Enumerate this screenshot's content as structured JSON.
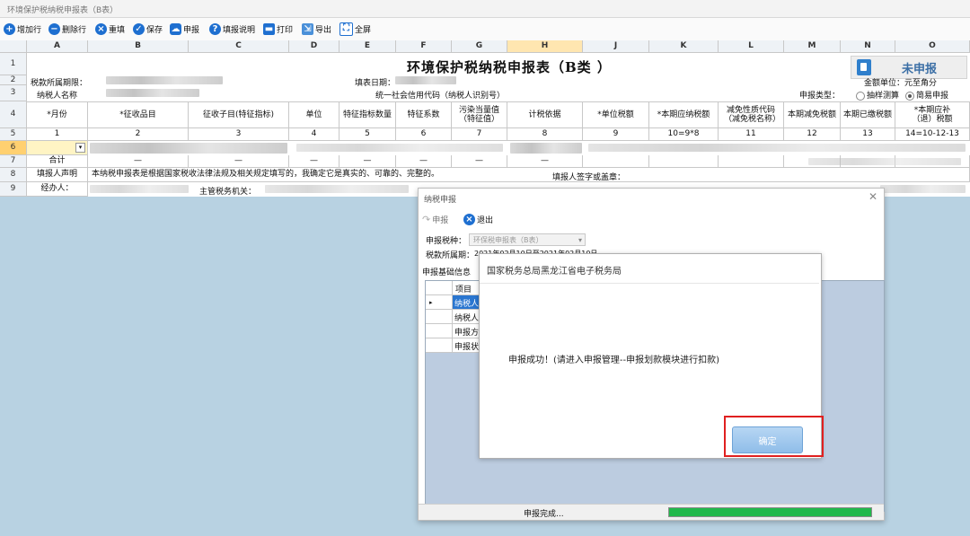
{
  "window": {
    "title": "环境保护税纳税申报表（B表）"
  },
  "toolbar": {
    "items": [
      {
        "icon": "plus-icon",
        "label": "增加行"
      },
      {
        "icon": "minus-icon",
        "label": "删除行"
      },
      {
        "icon": "close-icon",
        "label": "重填"
      },
      {
        "icon": "check-icon",
        "label": "保存"
      },
      {
        "icon": "cloud-upload-icon",
        "label": "申报"
      },
      {
        "icon": "help-icon",
        "label": "填报说明"
      },
      {
        "icon": "print-icon",
        "label": "打印"
      },
      {
        "icon": "export-icon",
        "label": "导出"
      },
      {
        "icon": "fullscreen-icon",
        "label": "全屏"
      }
    ]
  },
  "sheet": {
    "columns": [
      "A",
      "B",
      "C",
      "D",
      "E",
      "F",
      "G",
      "H",
      "J",
      "K",
      "L",
      "M",
      "N",
      "O"
    ],
    "selected_column": "H",
    "rows": [
      "1",
      "2",
      "3",
      "4",
      "5",
      "6",
      "7",
      "8",
      "9"
    ],
    "selected_row": "6",
    "title": "环境保护税纳税申报表（B类 ）",
    "status": "未申报",
    "period_label": "税款所属期限：",
    "fill_date_label": "填表日期：",
    "unit_label": "金额单位：元至角分",
    "taxpayer_label": "纳税人名称",
    "credit_code_label": "统一社会信用代码（纳税人识别号）",
    "declare_type_label": "申报类型：",
    "declare_option_1": "抽样测算",
    "declare_option_2": "简易申报",
    "headers": [
      "*月份",
      "*征收品目",
      "征收子目(特征指标)",
      "单位",
      "特征指标数量",
      "特征系数",
      "污染当量值（特征值）",
      "计税依据",
      "*单位税额",
      "*本期应纳税额",
      "减免性质代码（减免税名称）",
      "本期减免税额",
      "本期已缴税额",
      "*本期应补（退）税额"
    ],
    "numbers": [
      "1",
      "2",
      "3",
      "4",
      "5",
      "6",
      "7",
      "8",
      "9",
      "10=9*8",
      "11",
      "12",
      "13",
      "14=10-12-13"
    ],
    "total_label": "合计",
    "dash": "—",
    "declaration_label": "填报人声明",
    "declaration_text": "本纳税申报表是根据国家税收法律法规及相关规定填写的，我确定它是真实的、可靠的、完整的。",
    "signature_label": "填报人签字或盖章：",
    "agent_label": "经办人：",
    "tax_authority_label": "主管税务机关："
  },
  "declare_dialog": {
    "title": "纳税申报",
    "declare_button": "申报",
    "exit_button": "退出",
    "tax_type_label": "申报税种：",
    "tax_type_value": "环保税申报表（B表）",
    "period_label": "税款所属期：",
    "period_value": "2021年02月10日至2021年02月10日",
    "tab_label": "申报基础信息",
    "grid_header": "项目",
    "grid_rows": [
      "纳税人识别号",
      "纳税人名称",
      "申报方式",
      "申报状态"
    ],
    "status_text": "申报完成..."
  },
  "message_box": {
    "title": "国家税务总局黑龙江省电子税务局",
    "text": "申报成功！(请进入申报管理--申报划款模块进行扣款)",
    "ok_label": "确定"
  },
  "colors": {
    "accent": "#1e6fd0",
    "progress": "#21b84b",
    "highlight": "#e02020"
  }
}
